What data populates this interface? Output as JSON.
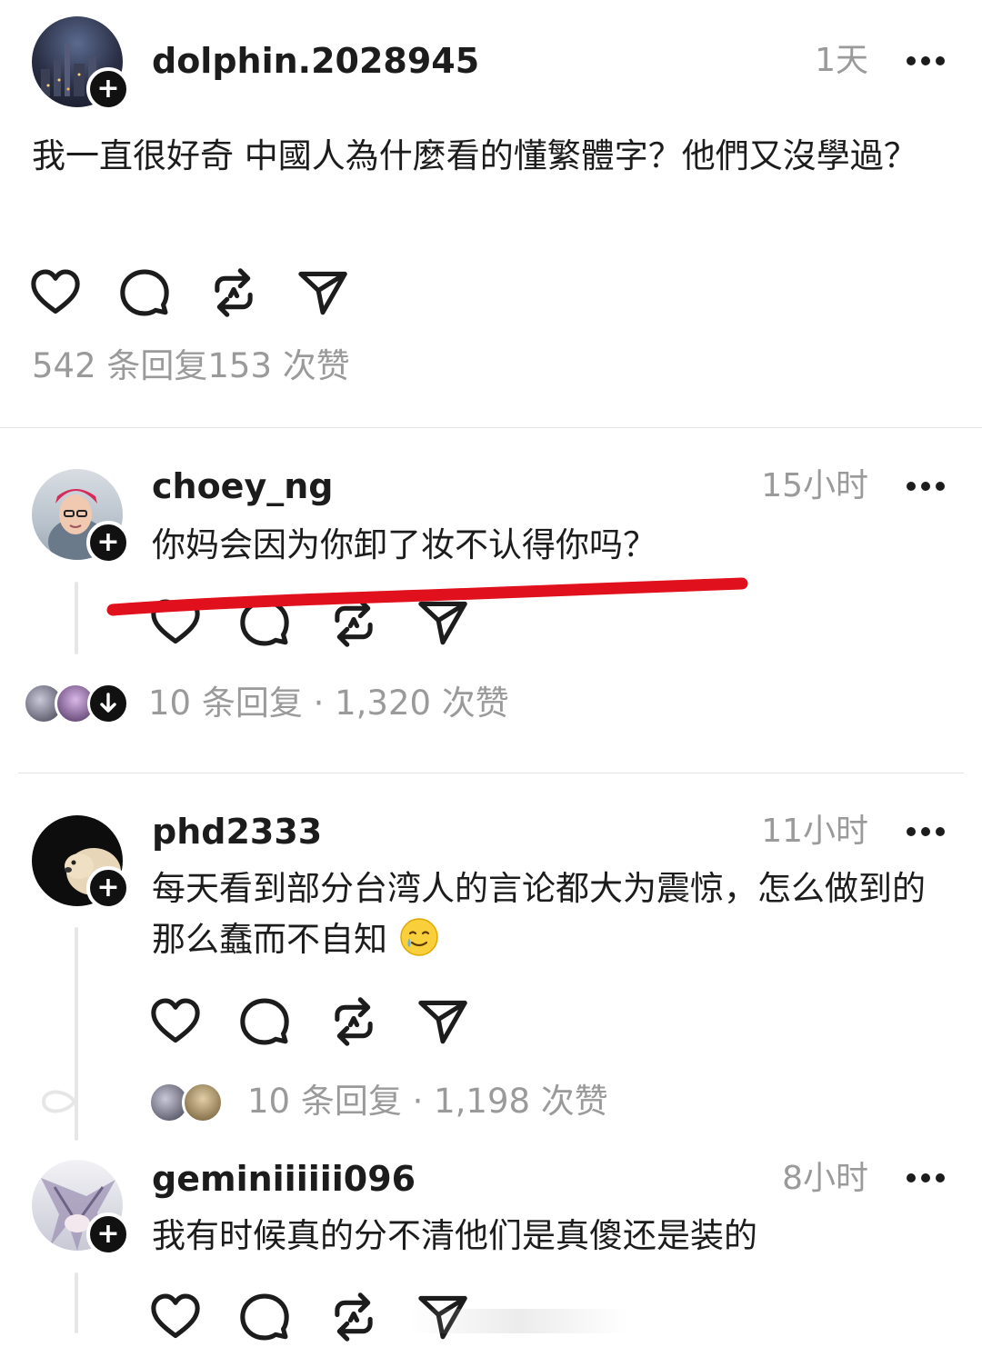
{
  "post": {
    "username": "dolphin.2028945",
    "time": "1天",
    "text": "我一直很好奇 中國人為什麼看的懂繁體字？他們又沒學過？",
    "stats": "542 条回复153 次赞"
  },
  "comments": [
    {
      "username": "choey_ng",
      "time": "15小时",
      "text": "你妈会因为你卸了妆不认得你吗？",
      "stats": "10 条回复 · 1,320 次赞"
    },
    {
      "username": "phd2333",
      "time": "11小时",
      "text": "每天看到部分台湾人的言论都大为震惊，怎么做到的那么蠢而不自知",
      "stats": "10 条回复 · 1,198 次赞"
    },
    {
      "username": "geminiiiiii096",
      "time": "8小时",
      "text": "我有时候真的分不清他们是真傻还是装的"
    }
  ],
  "icons": [
    "heart-icon",
    "comment-icon",
    "repost-icon",
    "share-icon",
    "more-icon",
    "plus-icon",
    "arrow-down-icon",
    "emoji-smile-tear"
  ],
  "colors": {
    "annotation_red": "#e0101c",
    "muted": "#9a9a9a",
    "text": "#1c1c1c"
  }
}
